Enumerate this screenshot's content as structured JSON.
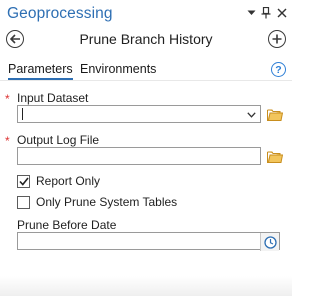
{
  "pane": {
    "title": "Geoprocessing",
    "icons": [
      "chevron-down-icon",
      "pin-icon",
      "close-icon"
    ]
  },
  "tool": {
    "title": "Prune Branch History",
    "back_icon": "back-arrow-icon",
    "add_icon": "add-icon"
  },
  "tabs": [
    {
      "label": "Parameters",
      "active": true
    },
    {
      "label": "Environments",
      "active": false
    }
  ],
  "help": {
    "glyph": "?"
  },
  "params": {
    "input_dataset": {
      "label": "Input Dataset",
      "value": "",
      "required": true
    },
    "output_log_file": {
      "label": "Output Log File",
      "value": "",
      "required": true
    },
    "report_only": {
      "label": "Report Only",
      "checked": true
    },
    "only_prune_system_tables": {
      "label": "Only Prune System Tables",
      "checked": false
    },
    "prune_before_date": {
      "label": "Prune Before Date",
      "value": ""
    }
  },
  "required_marker": "*",
  "colors": {
    "accent": "#2e6fb3",
    "required": "#d33333",
    "folder": "#e8b44a"
  }
}
